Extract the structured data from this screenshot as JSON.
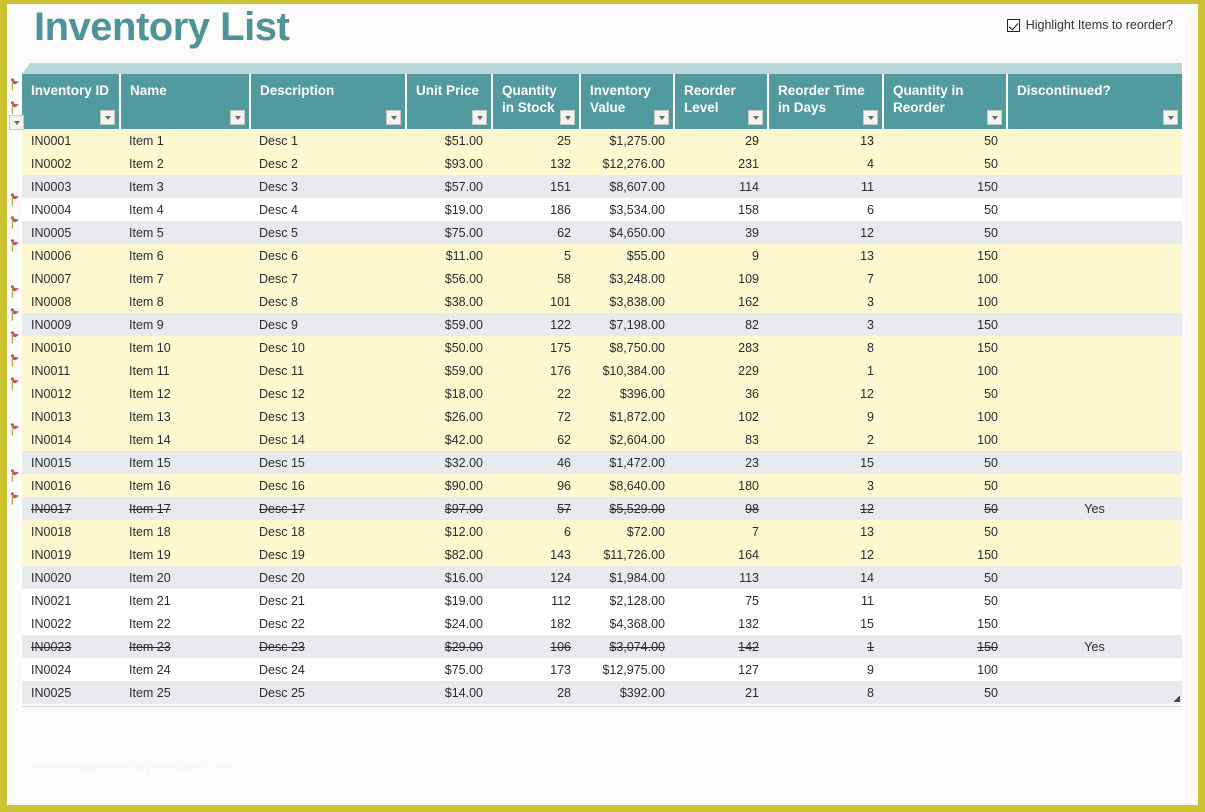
{
  "header": {
    "title": "Inventory List",
    "highlight_label": "Highlight Items to reorder?",
    "highlight_checked": true
  },
  "watermark": "www.omagedinventory-templates.com",
  "colors": {
    "header_teal": "#519a9f",
    "title_teal": "#4f9399",
    "accent_strip": "#b7d7d8",
    "page_frame": "#ccc333",
    "reorder_highlight": "#fdf8cf",
    "band_gray": "#e8eaee",
    "discontinued_text": "#b6b6b6",
    "flag_marker": "#c0506b"
  },
  "table": {
    "columns": [
      {
        "label": "Inventory ID",
        "align": "left"
      },
      {
        "label": "Name",
        "align": "left"
      },
      {
        "label": "Description",
        "align": "left"
      },
      {
        "label": "Unit Price",
        "align": "right"
      },
      {
        "label": "Quantity in Stock",
        "align": "right"
      },
      {
        "label": "Inventory Value",
        "align": "right"
      },
      {
        "label": "Reorder Level",
        "align": "right"
      },
      {
        "label": "Reorder Time in Days",
        "align": "right"
      },
      {
        "label": "Quantity in Reorder",
        "align": "right"
      },
      {
        "label": "Discontinued?",
        "align": "center"
      }
    ],
    "rows": [
      {
        "id": "IN0001",
        "name": "Item 1",
        "desc": "Desc 1",
        "price": "$51.00",
        "stock": "25",
        "value": "$1,275.00",
        "reorder_level": "29",
        "reorder_days": "13",
        "qty_reorder": "50",
        "discontinued": "",
        "flag": true,
        "band": "reorder"
      },
      {
        "id": "IN0002",
        "name": "Item 2",
        "desc": "Desc 2",
        "price": "$93.00",
        "stock": "132",
        "value": "$12,276.00",
        "reorder_level": "231",
        "reorder_days": "4",
        "qty_reorder": "50",
        "discontinued": "",
        "flag": true,
        "band": "reorder"
      },
      {
        "id": "IN0003",
        "name": "Item 3",
        "desc": "Desc 3",
        "price": "$57.00",
        "stock": "151",
        "value": "$8,607.00",
        "reorder_level": "114",
        "reorder_days": "11",
        "qty_reorder": "150",
        "discontinued": "",
        "flag": false,
        "band": "band-gray"
      },
      {
        "id": "IN0004",
        "name": "Item 4",
        "desc": "Desc 4",
        "price": "$19.00",
        "stock": "186",
        "value": "$3,534.00",
        "reorder_level": "158",
        "reorder_days": "6",
        "qty_reorder": "50",
        "discontinued": "",
        "flag": false,
        "band": "band-white"
      },
      {
        "id": "IN0005",
        "name": "Item 5",
        "desc": "Desc 5",
        "price": "$75.00",
        "stock": "62",
        "value": "$4,650.00",
        "reorder_level": "39",
        "reorder_days": "12",
        "qty_reorder": "50",
        "discontinued": "",
        "flag": false,
        "band": "band-gray"
      },
      {
        "id": "IN0006",
        "name": "Item 6",
        "desc": "Desc 6",
        "price": "$11.00",
        "stock": "5",
        "value": "$55.00",
        "reorder_level": "9",
        "reorder_days": "13",
        "qty_reorder": "150",
        "discontinued": "",
        "flag": true,
        "band": "reorder"
      },
      {
        "id": "IN0007",
        "name": "Item 7",
        "desc": "Desc 7",
        "price": "$56.00",
        "stock": "58",
        "value": "$3,248.00",
        "reorder_level": "109",
        "reorder_days": "7",
        "qty_reorder": "100",
        "discontinued": "",
        "flag": true,
        "band": "reorder"
      },
      {
        "id": "IN0008",
        "name": "Item 8",
        "desc": "Desc 8",
        "price": "$38.00",
        "stock": "101",
        "value": "$3,838.00",
        "reorder_level": "162",
        "reorder_days": "3",
        "qty_reorder": "100",
        "discontinued": "",
        "flag": true,
        "band": "reorder"
      },
      {
        "id": "IN0009",
        "name": "Item 9",
        "desc": "Desc 9",
        "price": "$59.00",
        "stock": "122",
        "value": "$7,198.00",
        "reorder_level": "82",
        "reorder_days": "3",
        "qty_reorder": "150",
        "discontinued": "",
        "flag": false,
        "band": "band-gray"
      },
      {
        "id": "IN0010",
        "name": "Item 10",
        "desc": "Desc 10",
        "price": "$50.00",
        "stock": "175",
        "value": "$8,750.00",
        "reorder_level": "283",
        "reorder_days": "8",
        "qty_reorder": "150",
        "discontinued": "",
        "flag": true,
        "band": "reorder"
      },
      {
        "id": "IN0011",
        "name": "Item 11",
        "desc": "Desc 11",
        "price": "$59.00",
        "stock": "176",
        "value": "$10,384.00",
        "reorder_level": "229",
        "reorder_days": "1",
        "qty_reorder": "100",
        "discontinued": "",
        "flag": true,
        "band": "reorder"
      },
      {
        "id": "IN0012",
        "name": "Item 12",
        "desc": "Desc 12",
        "price": "$18.00",
        "stock": "22",
        "value": "$396.00",
        "reorder_level": "36",
        "reorder_days": "12",
        "qty_reorder": "50",
        "discontinued": "",
        "flag": true,
        "band": "reorder"
      },
      {
        "id": "IN0013",
        "name": "Item 13",
        "desc": "Desc 13",
        "price": "$26.00",
        "stock": "72",
        "value": "$1,872.00",
        "reorder_level": "102",
        "reorder_days": "9",
        "qty_reorder": "100",
        "discontinued": "",
        "flag": true,
        "band": "reorder"
      },
      {
        "id": "IN0014",
        "name": "Item 14",
        "desc": "Desc 14",
        "price": "$42.00",
        "stock": "62",
        "value": "$2,604.00",
        "reorder_level": "83",
        "reorder_days": "2",
        "qty_reorder": "100",
        "discontinued": "",
        "flag": true,
        "band": "reorder"
      },
      {
        "id": "IN0015",
        "name": "Item 15",
        "desc": "Desc 15",
        "price": "$32.00",
        "stock": "46",
        "value": "$1,472.00",
        "reorder_level": "23",
        "reorder_days": "15",
        "qty_reorder": "50",
        "discontinued": "",
        "flag": false,
        "band": "band-gray"
      },
      {
        "id": "IN0016",
        "name": "Item 16",
        "desc": "Desc 16",
        "price": "$90.00",
        "stock": "96",
        "value": "$8,640.00",
        "reorder_level": "180",
        "reorder_days": "3",
        "qty_reorder": "50",
        "discontinued": "",
        "flag": true,
        "band": "reorder"
      },
      {
        "id": "IN0017",
        "name": "Item 17",
        "desc": "Desc 17",
        "price": "$97.00",
        "stock": "57",
        "value": "$5,529.00",
        "reorder_level": "98",
        "reorder_days": "12",
        "qty_reorder": "50",
        "discontinued": "Yes",
        "flag": false,
        "band": "band-gray",
        "struck": true
      },
      {
        "id": "IN0018",
        "name": "Item 18",
        "desc": "Desc 18",
        "price": "$12.00",
        "stock": "6",
        "value": "$72.00",
        "reorder_level": "7",
        "reorder_days": "13",
        "qty_reorder": "50",
        "discontinued": "",
        "flag": true,
        "band": "reorder"
      },
      {
        "id": "IN0019",
        "name": "Item 19",
        "desc": "Desc 19",
        "price": "$82.00",
        "stock": "143",
        "value": "$11,726.00",
        "reorder_level": "164",
        "reorder_days": "12",
        "qty_reorder": "150",
        "discontinued": "",
        "flag": true,
        "band": "reorder"
      },
      {
        "id": "IN0020",
        "name": "Item 20",
        "desc": "Desc 20",
        "price": "$16.00",
        "stock": "124",
        "value": "$1,984.00",
        "reorder_level": "113",
        "reorder_days": "14",
        "qty_reorder": "50",
        "discontinued": "",
        "flag": false,
        "band": "band-gray"
      },
      {
        "id": "IN0021",
        "name": "Item 21",
        "desc": "Desc 21",
        "price": "$19.00",
        "stock": "112",
        "value": "$2,128.00",
        "reorder_level": "75",
        "reorder_days": "11",
        "qty_reorder": "50",
        "discontinued": "",
        "flag": false,
        "band": "band-white"
      },
      {
        "id": "IN0022",
        "name": "Item 22",
        "desc": "Desc 22",
        "price": "$24.00",
        "stock": "182",
        "value": "$4,368.00",
        "reorder_level": "132",
        "reorder_days": "15",
        "qty_reorder": "150",
        "discontinued": "",
        "flag": false,
        "band": "band-white"
      },
      {
        "id": "IN0023",
        "name": "Item 23",
        "desc": "Desc 23",
        "price": "$29.00",
        "stock": "106",
        "value": "$3,074.00",
        "reorder_level": "142",
        "reorder_days": "1",
        "qty_reorder": "150",
        "discontinued": "Yes",
        "flag": false,
        "band": "band-gray",
        "struck": true
      },
      {
        "id": "IN0024",
        "name": "Item 24",
        "desc": "Desc 24",
        "price": "$75.00",
        "stock": "173",
        "value": "$12,975.00",
        "reorder_level": "127",
        "reorder_days": "9",
        "qty_reorder": "100",
        "discontinued": "",
        "flag": false,
        "band": "band-white"
      },
      {
        "id": "IN0025",
        "name": "Item 25",
        "desc": "Desc 25",
        "price": "$14.00",
        "stock": "28",
        "value": "$392.00",
        "reorder_level": "21",
        "reorder_days": "8",
        "qty_reorder": "50",
        "discontinued": "",
        "flag": false,
        "band": "band-gray"
      }
    ]
  }
}
